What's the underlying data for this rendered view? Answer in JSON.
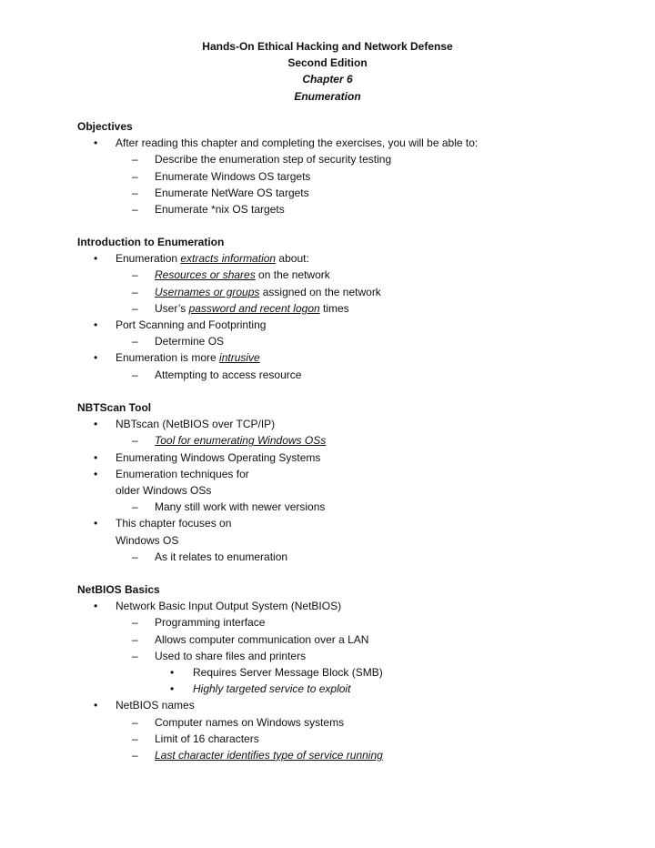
{
  "header": {
    "title": "Hands-On Ethical Hacking and Network Defense",
    "edition": "Second Edition",
    "chapter": "Chapter 6",
    "chapter_title": "Enumeration"
  },
  "markers": {
    "bullet": "•",
    "dash": "–"
  },
  "sections": [
    {
      "heading": "Objectives",
      "lines": [
        {
          "level": 1,
          "segments": [
            {
              "text": "After reading this chapter and completing the exercises, you will be able to:"
            }
          ]
        },
        {
          "level": 2,
          "segments": [
            {
              "text": "Describe the enumeration step of security testing"
            }
          ]
        },
        {
          "level": 2,
          "segments": [
            {
              "text": "Enumerate Windows OS targets"
            }
          ]
        },
        {
          "level": 2,
          "segments": [
            {
              "text": "Enumerate NetWare OS targets"
            }
          ]
        },
        {
          "level": 2,
          "segments": [
            {
              "text": "Enumerate *nix OS targets"
            }
          ]
        }
      ]
    },
    {
      "heading": "Introduction to Enumeration",
      "lines": [
        {
          "level": 1,
          "segments": [
            {
              "text": "Enumeration "
            },
            {
              "text": "extracts information",
              "style": "em-u"
            },
            {
              "text": " about:"
            }
          ]
        },
        {
          "level": 2,
          "segments": [
            {
              "text": "Resources or shares",
              "style": "em-u"
            },
            {
              "text": " on the network"
            }
          ]
        },
        {
          "level": 2,
          "segments": [
            {
              "text": "Usernames or groups",
              "style": "em-u"
            },
            {
              "text": " assigned on the network"
            }
          ]
        },
        {
          "level": 2,
          "segments": [
            {
              "text": "User’s "
            },
            {
              "text": "password and recent logon",
              "style": "em-u"
            },
            {
              "text": " times"
            }
          ]
        },
        {
          "level": 1,
          "segments": [
            {
              "text": "Port Scanning and Footprinting"
            }
          ]
        },
        {
          "level": 2,
          "segments": [
            {
              "text": "Determine OS"
            }
          ]
        },
        {
          "level": 1,
          "segments": [
            {
              "text": "Enumeration is more "
            },
            {
              "text": "intrusive",
              "style": "em-u"
            }
          ]
        },
        {
          "level": 2,
          "segments": [
            {
              "text": "Attempting to access resource"
            }
          ]
        }
      ]
    },
    {
      "heading": "NBTScan Tool",
      "lines": [
        {
          "level": 1,
          "segments": [
            {
              "text": "NBTscan (NetBIOS over TCP/IP)"
            }
          ]
        },
        {
          "level": 2,
          "segments": [
            {
              "text": "Tool for enumerating Windows OSs",
              "style": "em-u"
            }
          ]
        },
        {
          "level": 1,
          "segments": [
            {
              "text": "Enumerating Windows Operating Systems"
            }
          ]
        },
        {
          "level": 1,
          "segments": [
            {
              "text": "Enumeration techniques for"
            }
          ]
        },
        {
          "level": 1,
          "continuation": true,
          "segments": [
            {
              "text": "older Windows OSs"
            }
          ]
        },
        {
          "level": 2,
          "segments": [
            {
              "text": "Many still work with newer versions"
            }
          ]
        },
        {
          "level": 1,
          "segments": [
            {
              "text": "This chapter focuses on"
            }
          ]
        },
        {
          "level": 1,
          "continuation": true,
          "segments": [
            {
              "text": "Windows OS"
            }
          ]
        },
        {
          "level": 2,
          "segments": [
            {
              "text": "As it relates to enumeration"
            }
          ]
        }
      ]
    },
    {
      "heading": "NetBIOS Basics",
      "lines": [
        {
          "level": 1,
          "segments": [
            {
              "text": "Network Basic Input Output System (NetBIOS)"
            }
          ]
        },
        {
          "level": 2,
          "segments": [
            {
              "text": "Programming interface"
            }
          ]
        },
        {
          "level": 2,
          "segments": [
            {
              "text": "Allows computer communication over a LAN"
            }
          ]
        },
        {
          "level": 2,
          "segments": [
            {
              "text": "Used to share files and printers"
            }
          ]
        },
        {
          "level": 3,
          "segments": [
            {
              "text": "Requires Server Message Block (SMB)"
            }
          ]
        },
        {
          "level": 3,
          "segments": [
            {
              "text": "Highly targeted service to exploit",
              "style": "em"
            }
          ]
        },
        {
          "level": 1,
          "segments": [
            {
              "text": "NetBIOS names"
            }
          ]
        },
        {
          "level": 2,
          "segments": [
            {
              "text": "Computer names on Windows systems"
            }
          ]
        },
        {
          "level": 2,
          "segments": [
            {
              "text": "Limit of 16 characters"
            }
          ]
        },
        {
          "level": 2,
          "segments": [
            {
              "text": "Last character identifies type of service running",
              "style": "em-u"
            }
          ]
        }
      ]
    }
  ]
}
